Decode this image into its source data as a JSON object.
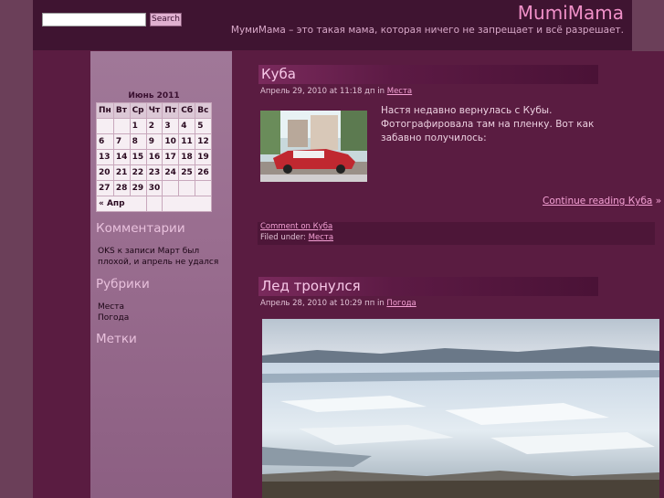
{
  "header": {
    "site_title": "MumiMama",
    "site_description": "МумиМама – это такая мама, которая ничего не запрещает и всё разрешает.",
    "search_button": "Search",
    "search_value": ""
  },
  "calendar": {
    "caption": "Июнь 2011",
    "weekdays": [
      "Пн",
      "Вт",
      "Ср",
      "Чт",
      "Пт",
      "Сб",
      "Вс"
    ],
    "weeks": [
      [
        "",
        "",
        "1",
        "2",
        "3",
        "4",
        "5"
      ],
      [
        "6",
        "7",
        "8",
        "9",
        "10",
        "11",
        "12"
      ],
      [
        "13",
        "14",
        "15",
        "16",
        "17",
        "18",
        "19"
      ],
      [
        "20",
        "21",
        "22",
        "23",
        "24",
        "25",
        "26"
      ],
      [
        "27",
        "28",
        "29",
        "30",
        "",
        "",
        ""
      ]
    ],
    "prev_link": "« Апр"
  },
  "sidebar": {
    "comments_title": "Комментарии",
    "comment_author": "OKS",
    "comment_connector": "к записи",
    "comment_post": "Март был плохой, и апрель не удался",
    "categories_title": "Рубрики",
    "categories": [
      "Места",
      "Погода"
    ],
    "tags_title": "Метки"
  },
  "posts": [
    {
      "title": "Куба",
      "date": "Апрель 29, 2010 at 11:18 дп",
      "in_word": "in",
      "category": "Места",
      "text": "Настя недавно вернулась с Кубы. Фотографировала там на пленку. Вот как забавно получилось:",
      "continue": "Continue reading Куба",
      "continue_suffix": "»",
      "comment_link": "Comment on Куба",
      "filed_under": "Filed under:",
      "filed_category": "Места"
    },
    {
      "title": "Лед тронулся",
      "date": "Апрель 28, 2010 at 10:29 пп",
      "in_word": "in",
      "category": "Погода"
    }
  ]
}
